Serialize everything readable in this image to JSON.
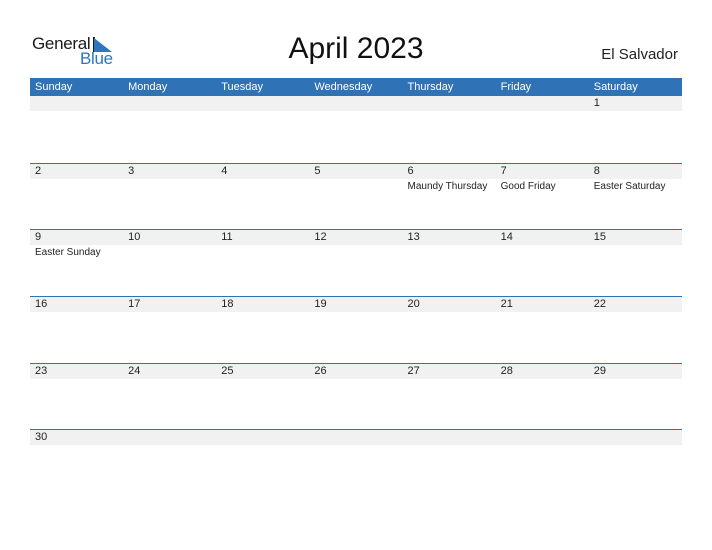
{
  "logo": {
    "line1": "General",
    "line2": "Blue"
  },
  "title": "April 2023",
  "country": "El Salvador",
  "colors": {
    "accent": "#2f72b5",
    "date_strip": "#f1f1f1"
  },
  "weekdays": [
    "Sunday",
    "Monday",
    "Tuesday",
    "Wednesday",
    "Thursday",
    "Friday",
    "Saturday"
  ],
  "weeks": [
    [
      {
        "date": "",
        "holiday": ""
      },
      {
        "date": "",
        "holiday": ""
      },
      {
        "date": "",
        "holiday": ""
      },
      {
        "date": "",
        "holiday": ""
      },
      {
        "date": "",
        "holiday": ""
      },
      {
        "date": "",
        "holiday": ""
      },
      {
        "date": "1",
        "holiday": ""
      }
    ],
    [
      {
        "date": "2",
        "holiday": ""
      },
      {
        "date": "3",
        "holiday": ""
      },
      {
        "date": "4",
        "holiday": ""
      },
      {
        "date": "5",
        "holiday": ""
      },
      {
        "date": "6",
        "holiday": "Maundy Thursday"
      },
      {
        "date": "7",
        "holiday": "Good Friday"
      },
      {
        "date": "8",
        "holiday": "Easter Saturday"
      }
    ],
    [
      {
        "date": "9",
        "holiday": "Easter Sunday"
      },
      {
        "date": "10",
        "holiday": ""
      },
      {
        "date": "11",
        "holiday": ""
      },
      {
        "date": "12",
        "holiday": ""
      },
      {
        "date": "13",
        "holiday": ""
      },
      {
        "date": "14",
        "holiday": ""
      },
      {
        "date": "15",
        "holiday": ""
      }
    ],
    [
      {
        "date": "16",
        "holiday": ""
      },
      {
        "date": "17",
        "holiday": ""
      },
      {
        "date": "18",
        "holiday": ""
      },
      {
        "date": "19",
        "holiday": ""
      },
      {
        "date": "20",
        "holiday": ""
      },
      {
        "date": "21",
        "holiday": ""
      },
      {
        "date": "22",
        "holiday": ""
      }
    ],
    [
      {
        "date": "23",
        "holiday": ""
      },
      {
        "date": "24",
        "holiday": ""
      },
      {
        "date": "25",
        "holiday": ""
      },
      {
        "date": "26",
        "holiday": ""
      },
      {
        "date": "27",
        "holiday": ""
      },
      {
        "date": "28",
        "holiday": ""
      },
      {
        "date": "29",
        "holiday": ""
      }
    ],
    [
      {
        "date": "30",
        "holiday": ""
      },
      {
        "date": "",
        "holiday": ""
      },
      {
        "date": "",
        "holiday": ""
      },
      {
        "date": "",
        "holiday": ""
      },
      {
        "date": "",
        "holiday": ""
      },
      {
        "date": "",
        "holiday": ""
      },
      {
        "date": "",
        "holiday": ""
      }
    ]
  ]
}
